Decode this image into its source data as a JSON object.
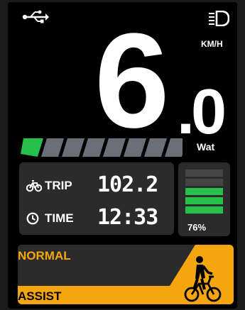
{
  "status": {
    "usb_icon": "usb-icon",
    "headlight_icon": "headlight-icon"
  },
  "speed": {
    "integer": "6",
    "dot": ".",
    "decimal": "0",
    "unit": "KM/H"
  },
  "power": {
    "label": "Wat",
    "segments_total": 8,
    "segments_active": 1,
    "active_color": "#27c04a",
    "inactive_color": "#6b7078"
  },
  "trip": {
    "label": "TRIP",
    "value": "102.2",
    "icon": "bicycle-icon"
  },
  "time": {
    "label": "TIME",
    "value": "12:33",
    "icon": "clock-icon"
  },
  "battery": {
    "percent_label": "76%",
    "level": 0.76,
    "segments_total": 5,
    "segments_active": 3,
    "active_color": "#27c04a",
    "inactive_color": "#454545"
  },
  "mode": {
    "normal_label": "NORMAL",
    "assist_label": "ASSIST",
    "accent_color": "#f5a60f",
    "walk_icon": "walk-assist-icon"
  }
}
